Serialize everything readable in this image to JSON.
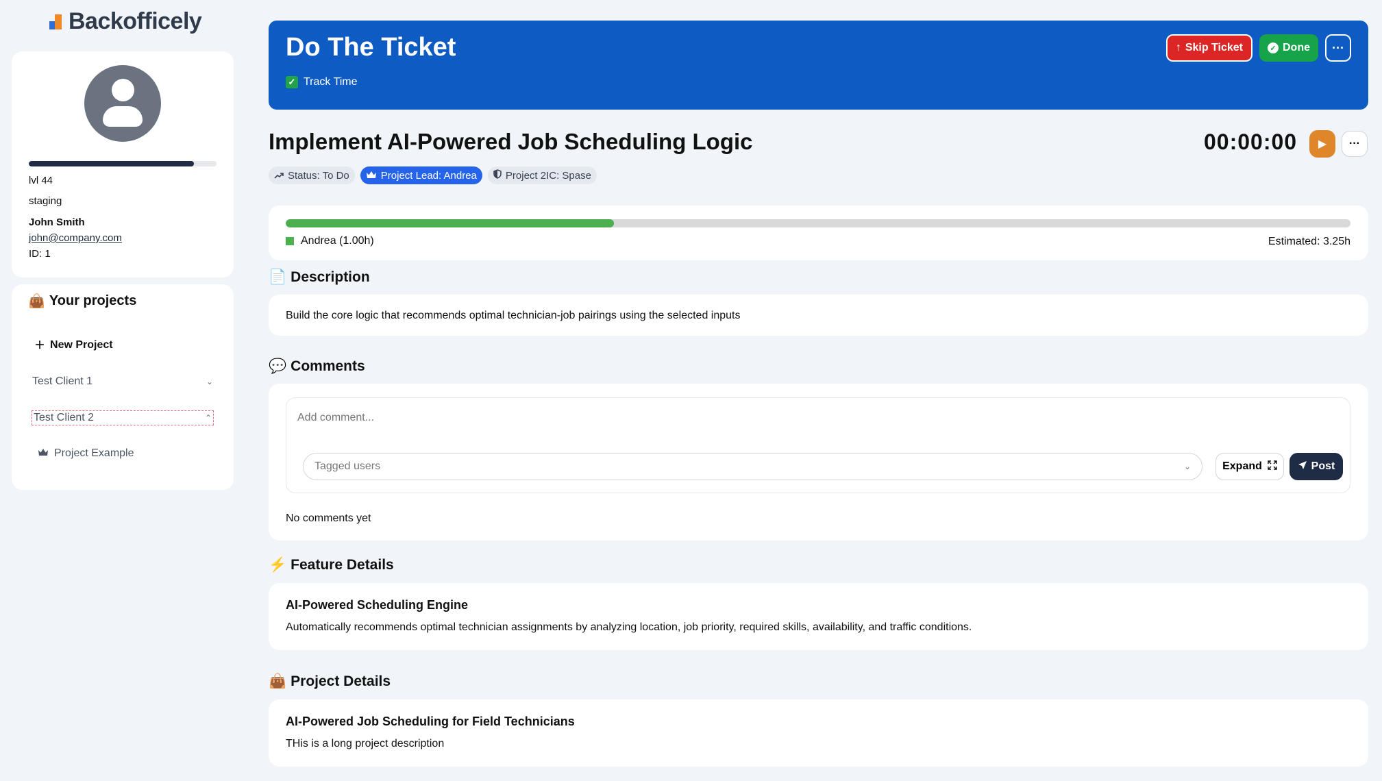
{
  "brand": {
    "name": "Backofficely"
  },
  "profile": {
    "level": "lvl 44",
    "level_progress": 0.88,
    "environment": "staging",
    "name": "John Smith",
    "email": "john@company.com",
    "id": "ID: 1"
  },
  "projects": {
    "title": "Your projects",
    "new_label": "New Project",
    "clients": [
      {
        "label": "Test Client 1",
        "expanded": false
      },
      {
        "label": "Test Client 2",
        "expanded": true
      }
    ],
    "items": [
      {
        "label": "Project Example"
      }
    ]
  },
  "banner": {
    "title": "Do The Ticket",
    "track_time_label": "Track Time",
    "track_time_checked": true,
    "skip_label": "Skip Ticket",
    "done_label": "Done",
    "more_label": "···"
  },
  "ticket": {
    "title": "Implement AI-Powered Job Scheduling Logic",
    "timer": "00:00:00",
    "status": "Status: To Do",
    "project_lead": "Project Lead: Andrea",
    "project_2ic": "Project 2IC: Spase"
  },
  "progress": {
    "fraction": 0.308,
    "legend_label": "Andrea (1.00h)",
    "estimated": "Estimated: 3.25h",
    "color": "#4caf50"
  },
  "description": {
    "heading": "Description",
    "text": "Build the core logic that recommends optimal technician-job pairings using the selected inputs"
  },
  "comments": {
    "heading": "Comments",
    "placeholder": "Add comment...",
    "tagged_placeholder": "Tagged users",
    "expand_label": "Expand",
    "post_label": "Post",
    "empty_text": "No comments yet"
  },
  "feature": {
    "heading": "Feature Details",
    "title": "AI-Powered Scheduling Engine",
    "text": "Automatically recommends optimal technician assignments by analyzing location, job priority, required skills, availability, and traffic conditions."
  },
  "project_details": {
    "heading": "Project Details",
    "title": "AI-Powered Job Scheduling for Field Technicians",
    "text": "THis is a long project description"
  },
  "colors": {
    "banner": "#0f5bc4",
    "skip": "#dc2626",
    "done": "#16a34a",
    "play": "#e0862a",
    "lead_pill": "#2563eb",
    "post": "#1e2d45"
  }
}
